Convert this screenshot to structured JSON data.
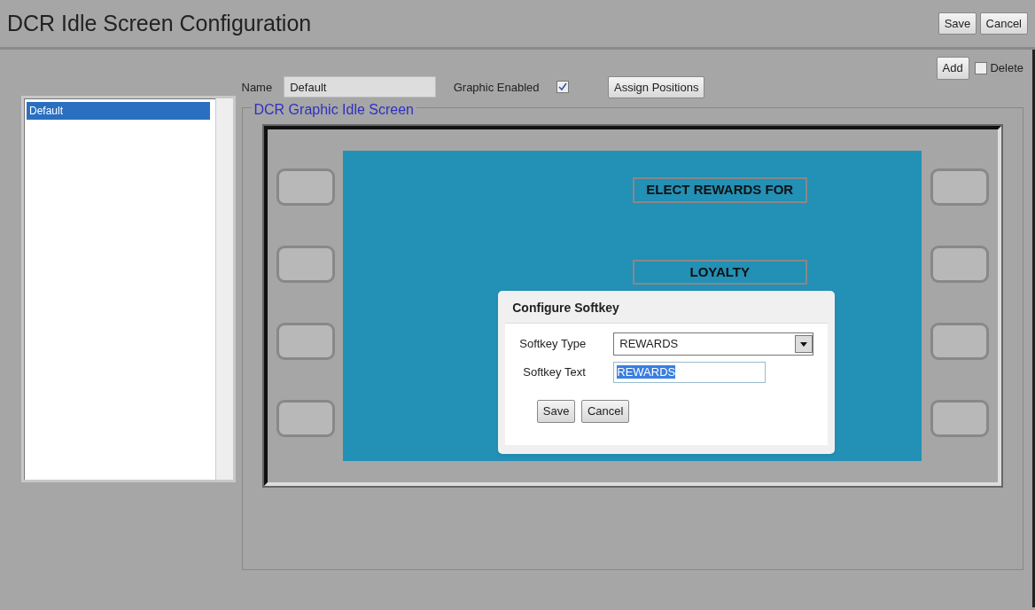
{
  "window": {
    "title": "DCR Idle Screen Configuration"
  },
  "header_buttons": [
    "Save",
    "Cancel"
  ],
  "toolbar": {
    "add": "Add",
    "delete": {
      "label": "Delete",
      "checked": false
    }
  },
  "configurations": [
    {
      "label": "Default",
      "selected": true
    }
  ],
  "form": {
    "name_label": "Name",
    "name_value": "Default",
    "graphic_label": "Graphic Enabled",
    "graphic_enabled": true,
    "assign": "Assign Positions"
  },
  "fieldset": {
    "legend": "DCR Graphic Idle Screen"
  },
  "screen": {
    "lines": [
      "ELECT REWARDS FOR",
      "LOYALTY"
    ]
  },
  "dialog": {
    "title": "Configure Softkey",
    "type_label": "Softkey Type",
    "type_value": "REWARDS",
    "text_label": "Softkey Text",
    "text_value": "REWARDS",
    "text_selected": true,
    "buttons": [
      "Save",
      "Cancel"
    ]
  }
}
